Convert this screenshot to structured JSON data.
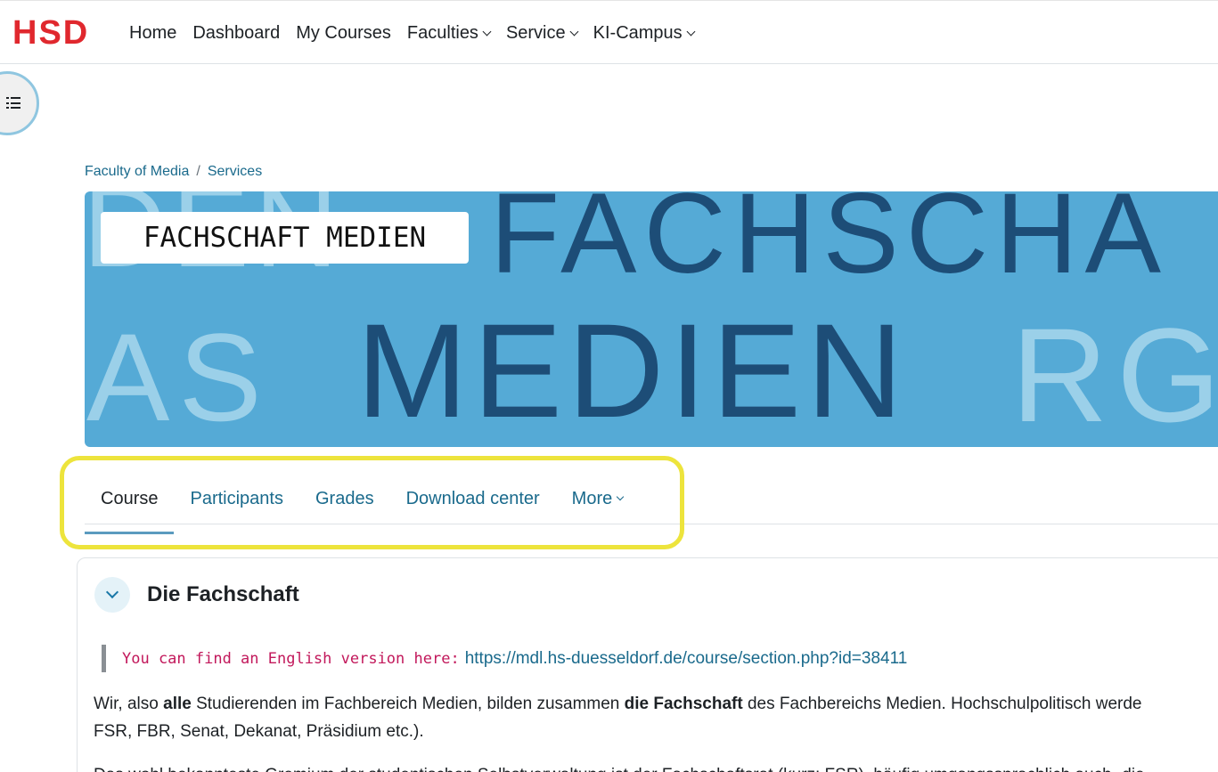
{
  "navbar": {
    "logo": "HSD",
    "items": [
      {
        "label": "Home",
        "dropdown": false
      },
      {
        "label": "Dashboard",
        "dropdown": false
      },
      {
        "label": "My Courses",
        "dropdown": false
      },
      {
        "label": "Faculties",
        "dropdown": true
      },
      {
        "label": "Service",
        "dropdown": true
      },
      {
        "label": "KI-Campus",
        "dropdown": true
      }
    ]
  },
  "drawer": {
    "icon": "list-icon"
  },
  "breadcrumb": {
    "items": [
      "Faculty of Media",
      "Services"
    ],
    "separator": "/"
  },
  "banner": {
    "title": "FACHSCHAFT MEDIEN",
    "bg_word_top": "FACHSCHA",
    "bg_word_main": "MEDIEN",
    "ghost_left_top": "DEN",
    "ghost_left_bottom": "AS",
    "ghost_right": "RG"
  },
  "tabs": {
    "items": [
      {
        "label": "Course",
        "active": true
      },
      {
        "label": "Participants",
        "active": false
      },
      {
        "label": "Grades",
        "active": false
      },
      {
        "label": "Download center",
        "active": false
      },
      {
        "label": "More",
        "active": false,
        "dropdown": true
      }
    ]
  },
  "section": {
    "title": "Die Fachschaft",
    "quote_code": "You can find an English version here:",
    "quote_link": "https://mdl.hs-duesseldorf.de/course/section.php?id=38411",
    "para1_line1_a": "Wir, also ",
    "para1_line1_b": "alle",
    "para1_line1_c": " Studierenden im Fachbereich Medien, bilden zusammen ",
    "para1_line1_d": "die Fachschaft",
    "para1_line1_e": " des Fachbereichs Medien. Hochschulpolitisch werde",
    "para1_line2": "FSR, FBR, Senat, Dekanat, Präsidium etc.).",
    "para2": "Das wohl bekannteste Gremium der studentischen Selbstverwaltung ist der Fachschaftsrat (kurz: FSR), häufig umgangssprachlich auch „die"
  },
  "colors": {
    "brand": "#e0282e",
    "link": "#1a6a8c",
    "banner": "#55aad6",
    "highlight": "#ede43c"
  }
}
